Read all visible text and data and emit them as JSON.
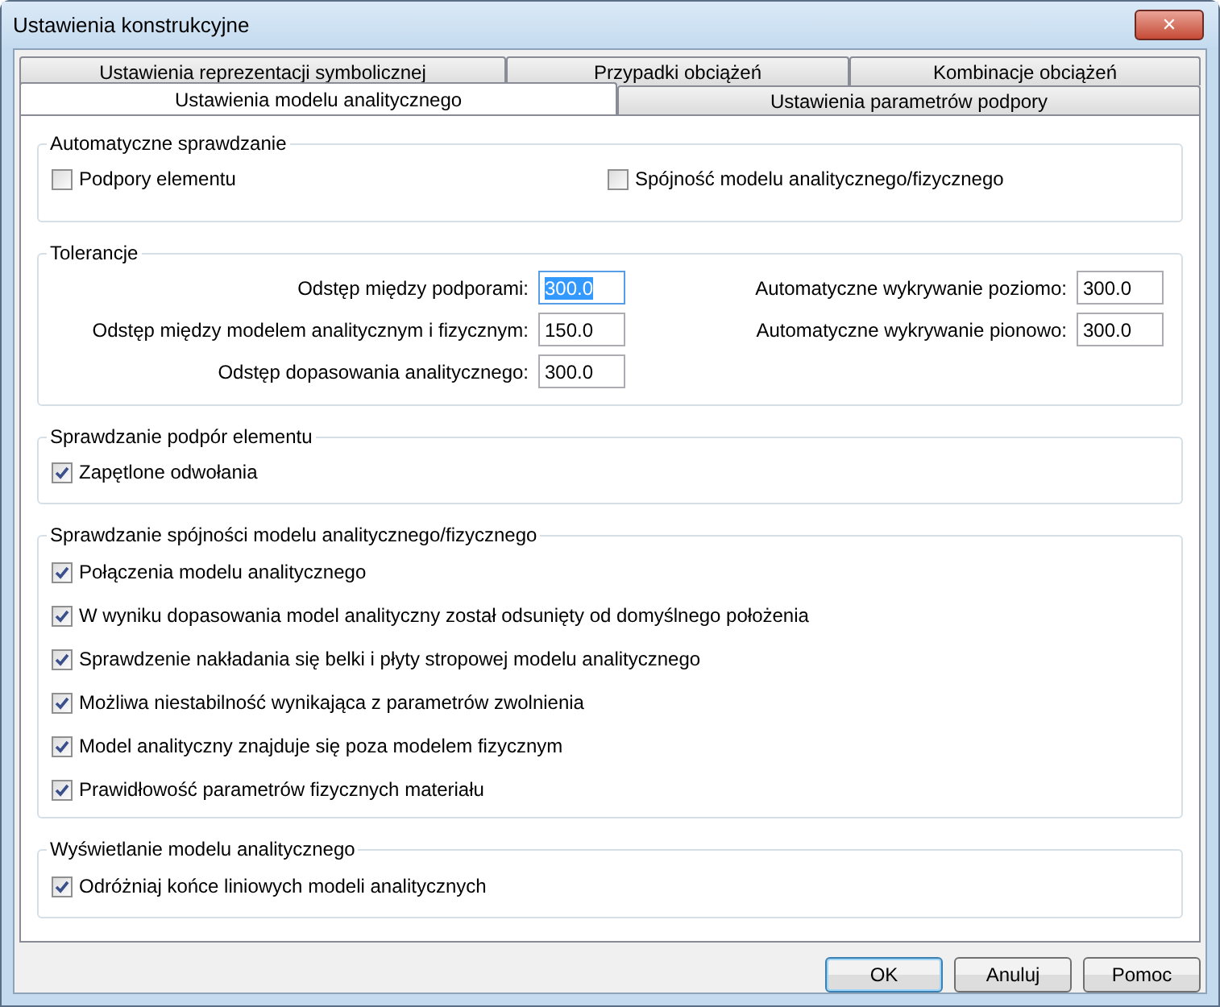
{
  "window": {
    "title": "Ustawienia konstrukcyjne",
    "close": "✕"
  },
  "tab_rows": [
    [
      {
        "label": "Ustawienia reprezentacji symbolicznej",
        "selected": false
      },
      {
        "label": "Przypadki obciążeń",
        "selected": false
      },
      {
        "label": "Kombinacje obciążeń",
        "selected": false
      }
    ],
    [
      {
        "label": "Ustawienia modelu analitycznego",
        "selected": true
      },
      {
        "label": "Ustawienia parametrów podpory",
        "selected": false
      }
    ]
  ],
  "auto_check": {
    "title": "Automatyczne sprawdzanie",
    "options": [
      {
        "label": "Podpory elementu",
        "checked": false
      },
      {
        "label": "Spójność modelu analitycznego/fizycznego",
        "checked": false
      }
    ]
  },
  "tolerances": {
    "title": "Tolerancje",
    "left": [
      {
        "label": "Odstęp między podporami:",
        "value": "300.0",
        "text_selected": true
      },
      {
        "label": "Odstęp między modelem analitycznym i fizycznym:",
        "value": "150.0",
        "text_selected": false
      },
      {
        "label": "Odstęp dopasowania analitycznego:",
        "value": "300.0",
        "text_selected": false
      }
    ],
    "right": [
      {
        "label": "Automatyczne wykrywanie poziomo:",
        "value": "300.0",
        "text_selected": false
      },
      {
        "label": "Automatyczne wykrywanie pionowo:",
        "value": "300.0",
        "text_selected": false
      }
    ]
  },
  "groups": [
    {
      "title": "Sprawdzanie podpór elementu",
      "options": [
        {
          "label": "Zapętlone odwołania",
          "checked": true
        }
      ]
    },
    {
      "title": "Sprawdzanie spójności modelu analitycznego/fizycznego",
      "options": [
        {
          "label": "Połączenia modelu analitycznego",
          "checked": true
        },
        {
          "label": "W wyniku dopasowania model analityczny został odsunięty od domyślnego położenia",
          "checked": true
        },
        {
          "label": "Sprawdzenie nakładania się belki i płyty stropowej modelu analitycznego",
          "checked": true
        },
        {
          "label": "Możliwa niestabilność wynikająca z parametrów zwolnienia",
          "checked": true
        },
        {
          "label": "Model analityczny znajduje się poza modelem fizycznym",
          "checked": true
        },
        {
          "label": "Prawidłowość parametrów fizycznych materiału",
          "checked": true
        }
      ]
    },
    {
      "title": "Wyświetlanie modelu analitycznego",
      "options": [
        {
          "label": "Odróżniaj końce liniowych modeli analitycznych",
          "checked": true
        }
      ]
    }
  ],
  "buttons": [
    {
      "label": "OK",
      "default": true
    },
    {
      "label": "Anuluj",
      "default": false
    },
    {
      "label": "Pomoc",
      "default": false
    }
  ]
}
